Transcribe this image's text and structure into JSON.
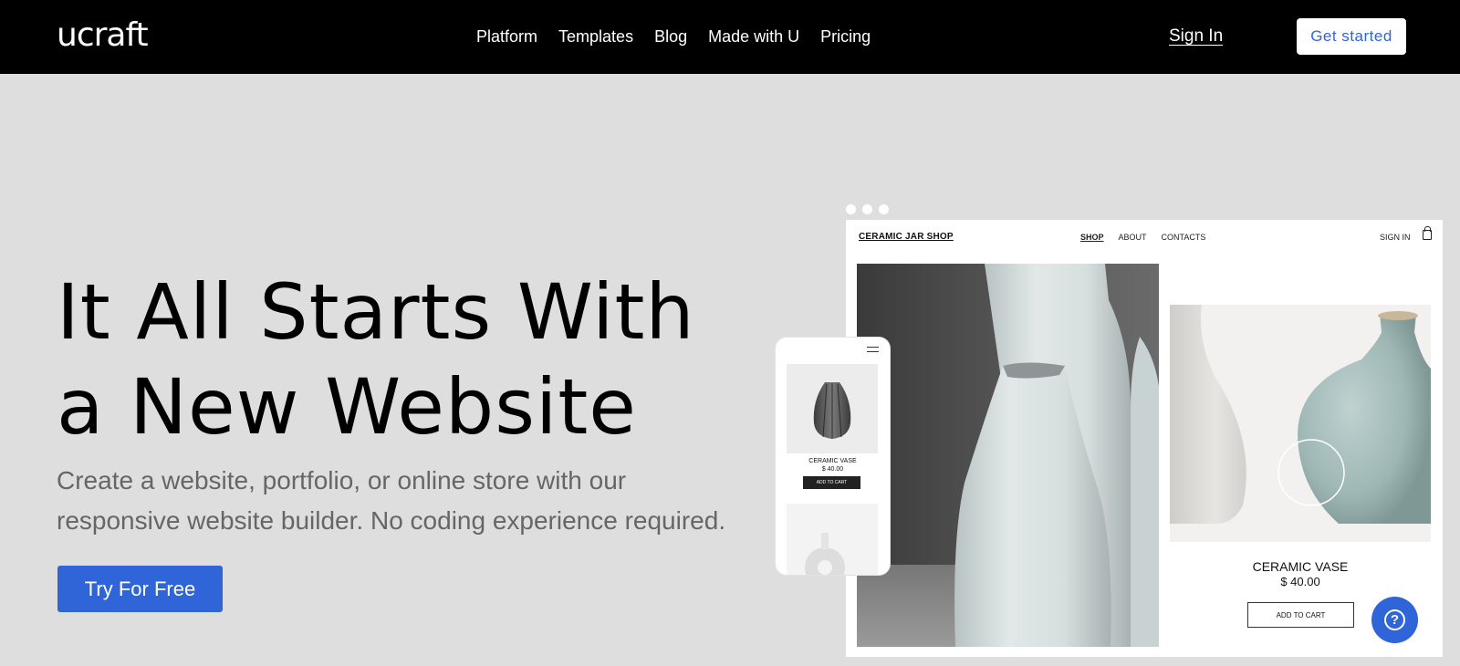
{
  "header": {
    "logo": "ucraft",
    "nav": [
      "Platform",
      "Templates",
      "Blog",
      "Made with U",
      "Pricing"
    ],
    "sign_in": "Sign In",
    "get_started": "Get started"
  },
  "hero": {
    "headline_line1": "It All Starts With",
    "headline_line2": "a New Website",
    "subtext": "Create a website, portfolio, or online store with our responsive website builder. No coding experience required.",
    "cta": "Try For Free"
  },
  "mockup": {
    "brand": "CERAMIC JAR SHOP",
    "nav": [
      "SHOP",
      "ABOUT",
      "CONTACTS"
    ],
    "sign_in": "SIGN IN",
    "product_title": "CERAMIC VASE",
    "product_price": "$ 40.00",
    "add_to_cart": "ADD TO CART",
    "phone": {
      "product_title": "CERAMIC VASE",
      "product_price": "$ 40.00",
      "add_to_cart": "ADD TO CART"
    }
  },
  "help": {
    "icon": "question-icon",
    "symbol": "?"
  },
  "colors": {
    "accent": "#2f65d9",
    "header_bg": "#000000",
    "page_bg": "#dedede"
  }
}
